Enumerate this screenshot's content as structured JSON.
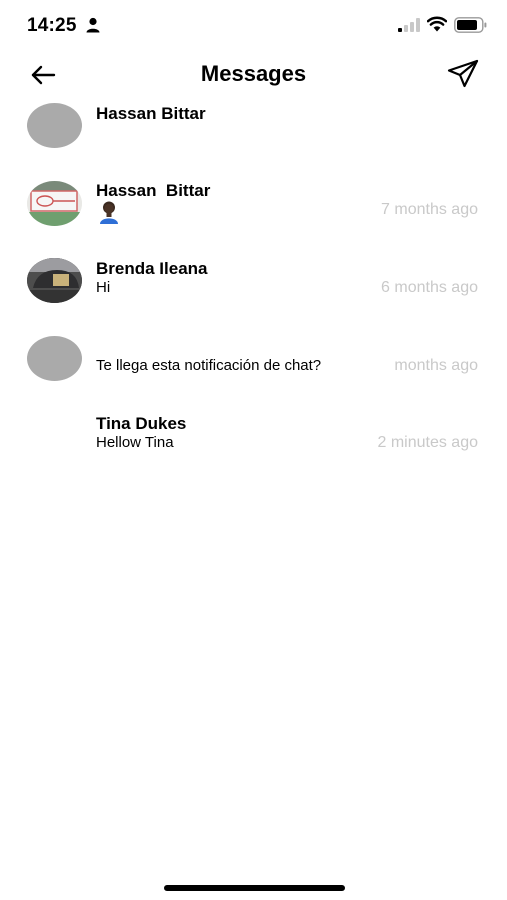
{
  "status_bar": {
    "time": "14:25"
  },
  "header": {
    "title": "Messages"
  },
  "icons": {
    "back": "arrow-left-icon",
    "send": "paper-plane-icon",
    "person": "person-icon",
    "signal": "cellular-signal-icon",
    "wifi": "wifi-icon",
    "battery": "battery-icon"
  },
  "conversations": [
    {
      "name": "Hassan Bittar",
      "preview": "",
      "time": "",
      "avatar": "gray"
    },
    {
      "name": "Hassan  Bittar",
      "preview": "",
      "time": "7 months ago",
      "avatar": "photo-card",
      "preview_emoji": "person-emoji"
    },
    {
      "name": "Brenda Ileana",
      "preview": "Hi",
      "time": "6 months ago",
      "avatar": "photo-car"
    },
    {
      "name": "",
      "preview": "Te llega esta notificación de chat?",
      "time": "months ago",
      "avatar": "gray"
    },
    {
      "name": "Tina Dukes",
      "preview": "Hellow Tina",
      "time": "2 minutes ago",
      "avatar": "none"
    }
  ],
  "colors": {
    "avatar_gray": "#aaaaaa",
    "timestamp": "#c9c9c9",
    "text": "#000000"
  }
}
